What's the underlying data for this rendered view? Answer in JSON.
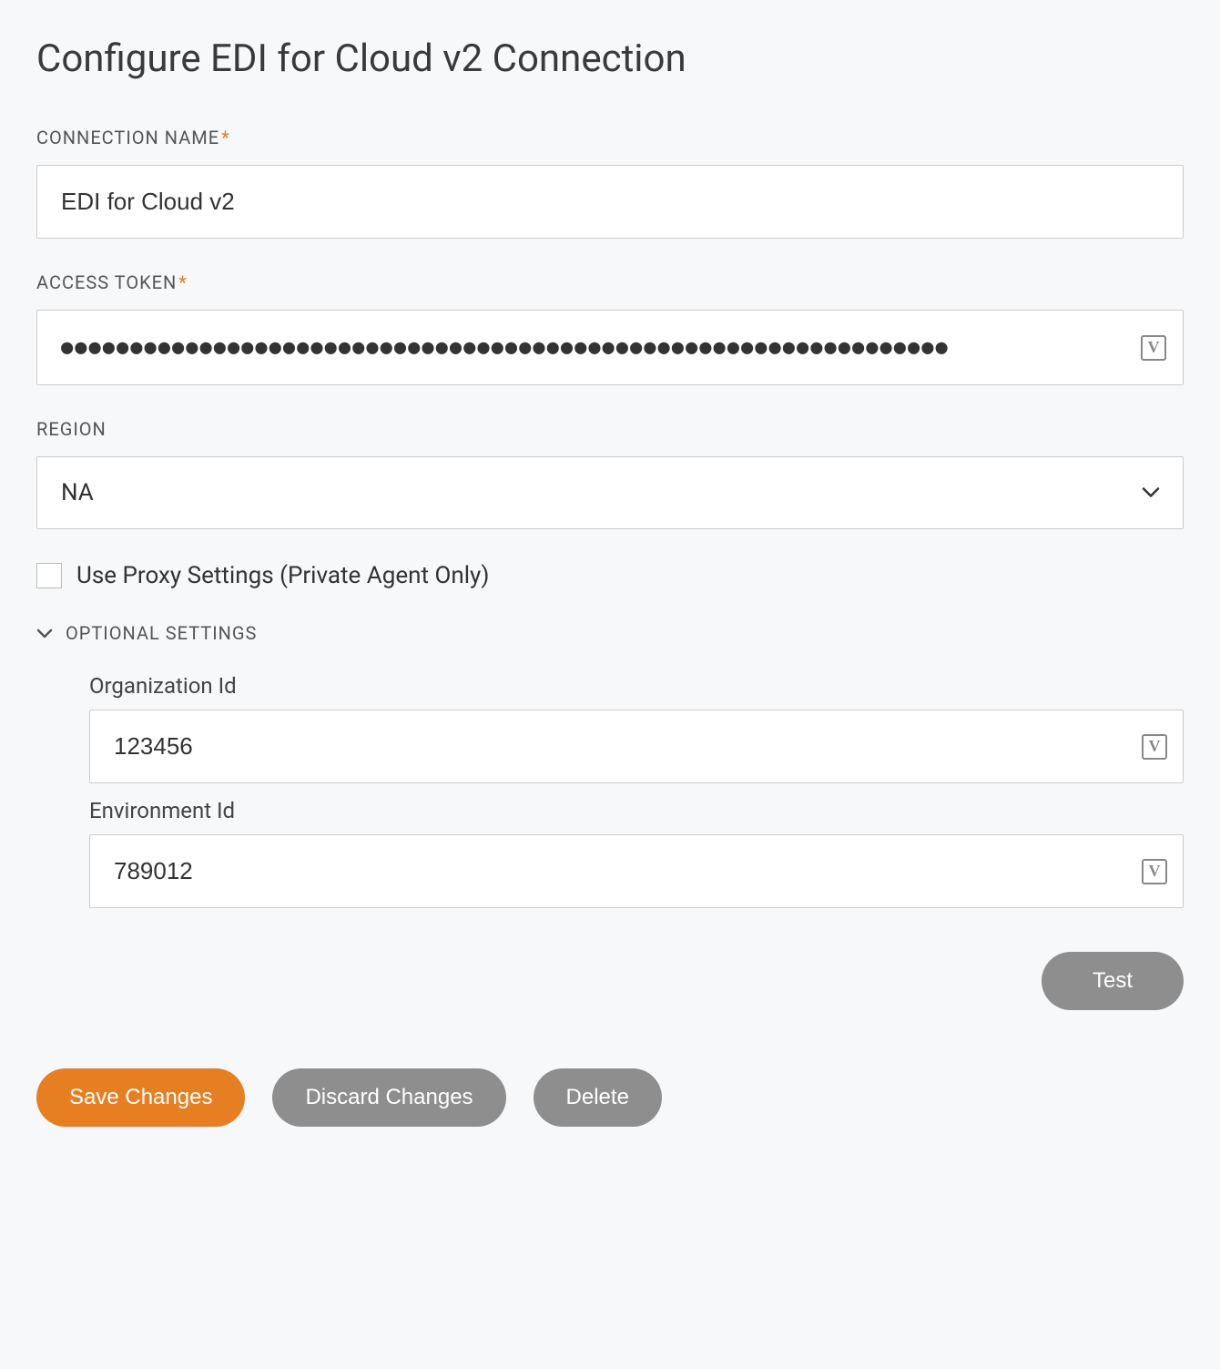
{
  "title": "Configure EDI for Cloud v2 Connection",
  "fields": {
    "connectionName": {
      "label": "CONNECTION NAME",
      "value": "EDI for Cloud v2",
      "required": true
    },
    "accessToken": {
      "label": "ACCESS TOKEN",
      "masked": "●●●●●●●●●●●●●●●●●●●●●●●●●●●●●●●●●●●●●●●●●●●●●●●●●●●●●●●●●●●●●●●●",
      "required": true,
      "variableIcon": "V"
    },
    "region": {
      "label": "REGION",
      "value": "NA"
    },
    "useProxy": {
      "label": "Use Proxy Settings (Private Agent Only)",
      "checked": false
    }
  },
  "optional": {
    "heading": "OPTIONAL SETTINGS",
    "organizationId": {
      "label": "Organization Id",
      "value": "123456",
      "variableIcon": "V"
    },
    "environmentId": {
      "label": "Environment Id",
      "value": "789012",
      "variableIcon": "V"
    }
  },
  "buttons": {
    "test": "Test",
    "save": "Save Changes",
    "discard": "Discard Changes",
    "delete": "Delete"
  }
}
